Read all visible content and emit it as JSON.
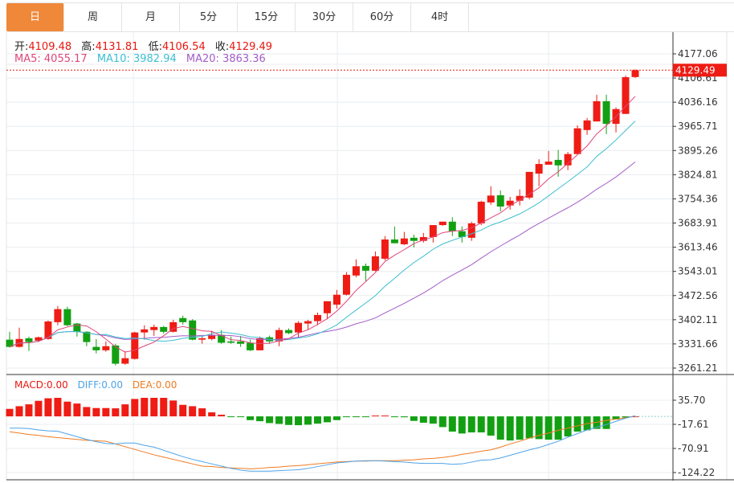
{
  "tabs": [
    "日",
    "周",
    "月",
    "5分",
    "15分",
    "30分",
    "60分",
    "4时"
  ],
  "active_tab": 0,
  "ohlc_info": {
    "open_label": "开:",
    "open": "4109.48",
    "high_label": "高:",
    "high": "4131.81",
    "low_label": "低:",
    "low": "4106.54",
    "close_label": "收:",
    "close": "4129.49"
  },
  "ma_info": {
    "ma5_label": "MA5:",
    "ma5": "4055.17",
    "ma10_label": "MA10:",
    "ma10": "3982.94",
    "ma20_label": "MA20:",
    "ma20": "3863.36"
  },
  "macd_info": {
    "macd_label": "MACD:",
    "macd": "0.00",
    "diff_label": "DIFF:",
    "diff": "0.00",
    "dea_label": "DEA:",
    "dea": "0.00"
  },
  "colors": {
    "tab_active": "#F0883A",
    "up": "#EE1C14",
    "down": "#12A012",
    "ma5": "#E0457B",
    "ma10": "#3CBFD0",
    "ma20": "#A45CC8",
    "diff": "#4DA3E8",
    "dea": "#F07A20"
  },
  "price_axis": {
    "ticks": [
      "4177.06",
      "4106.61",
      "4036.16",
      "3965.71",
      "3895.26",
      "3824.81",
      "3754.36",
      "3683.91",
      "3613.46",
      "3543.01",
      "3472.56",
      "3402.11",
      "3331.66",
      "3261.21"
    ],
    "current_price": "4129.49"
  },
  "macd_axis": {
    "ticks": [
      "35.70",
      "-17.61",
      "-70.91",
      "-124.22"
    ]
  },
  "chart_data": {
    "type": "candlestick",
    "open": [
      3344,
      3323,
      3348,
      3341,
      3346,
      3395,
      3433,
      3391,
      3367,
      3323,
      3313,
      3327,
      3274,
      3288,
      3365,
      3372,
      3381,
      3367,
      3407,
      3400,
      3344,
      3346,
      3358,
      3339,
      3339,
      3335,
      3313,
      3351,
      3339,
      3372,
      3365,
      3391,
      3398,
      3421,
      3446,
      3475,
      3531,
      3559,
      3545,
      3580,
      3636,
      3622,
      3641,
      3632,
      3643,
      3678,
      3688,
      3660,
      3641,
      3683,
      3744,
      3765,
      3735,
      3749,
      3758,
      3828,
      3854,
      3868,
      3852,
      3885,
      3955,
      3980,
      4039,
      3973,
      4002,
      4109.48
    ],
    "high": [
      3367,
      3379,
      3353,
      3353,
      3400,
      3442,
      3440,
      3393,
      3369,
      3346,
      3339,
      3332,
      3311,
      3367,
      3386,
      3388,
      3384,
      3402,
      3414,
      3404,
      3353,
      3370,
      3372,
      3353,
      3355,
      3344,
      3353,
      3356,
      3379,
      3377,
      3398,
      3402,
      3423,
      3456,
      3489,
      3541,
      3578,
      3566,
      3601,
      3646,
      3674,
      3658,
      3650,
      3655,
      3655,
      3685,
      3701,
      3674,
      3688,
      3749,
      3791,
      3779,
      3760,
      3782,
      3833,
      3870,
      3894,
      3897,
      3891,
      3969,
      3990,
      4058,
      4058,
      4021,
      4114,
      4131.81
    ],
    "low": [
      3321,
      3321,
      3311,
      3337,
      3344,
      3386,
      3383,
      3353,
      3325,
      3304,
      3309,
      3269,
      3271,
      3286,
      3344,
      3355,
      3362,
      3365,
      3388,
      3342,
      3332,
      3342,
      3332,
      3332,
      3323,
      3311,
      3313,
      3332,
      3325,
      3360,
      3351,
      3374,
      3386,
      3405,
      3435,
      3473,
      3526,
      3515,
      3543,
      3575,
      3625,
      3620,
      3613,
      3627,
      3627,
      3676,
      3646,
      3627,
      3632,
      3678,
      3737,
      3718,
      3723,
      3735,
      3753,
      3791,
      3856,
      3819,
      3838,
      3885,
      3941,
      3980,
      3943,
      3948,
      4002,
      4106.54
    ],
    "close": [
      3323,
      3346,
      3337,
      3351,
      3397,
      3433,
      3386,
      3367,
      3337,
      3313,
      3325,
      3274,
      3290,
      3365,
      3374,
      3381,
      3367,
      3395,
      3395,
      3344,
      3348,
      3358,
      3335,
      3335,
      3332,
      3313,
      3348,
      3339,
      3372,
      3363,
      3393,
      3398,
      3416,
      3456,
      3475,
      3533,
      3558,
      3545,
      3587,
      3636,
      3625,
      3639,
      3632,
      3643,
      3678,
      3688,
      3660,
      3643,
      3683,
      3746,
      3764,
      3732,
      3749,
      3763,
      3833,
      3856,
      3863,
      3852,
      3885,
      3960,
      3983,
      4039,
      3973,
      4016,
      4109,
      4129.49
    ],
    "macd_hist": [
      16.6,
      22.5,
      26.6,
      34.3,
      40,
      41,
      32.6,
      28.4,
      20.7,
      18.4,
      18.4,
      17.8,
      26.6,
      38.5,
      41,
      41,
      41,
      35,
      25.5,
      22.5,
      17.8,
      8.9,
      3.6,
      -1,
      -1.2,
      -8.3,
      -10.7,
      -14.8,
      -16.6,
      -19,
      -19.5,
      -18.4,
      -16,
      -13,
      -8.3,
      -1.2,
      -0.5,
      -0.5,
      1.8,
      1.8,
      -0.5,
      -2,
      -10,
      -14,
      -16,
      -23.7,
      -33.7,
      -37.9,
      -35.5,
      -35.5,
      -42.6,
      -51.5,
      -53.3,
      -51.5,
      -48.5,
      -50.3,
      -51.5,
      -51.5,
      -44.4,
      -33.7,
      -30.8,
      -27.8,
      -27.8,
      -7,
      -2.4,
      0
    ],
    "diff": [
      -26,
      -26,
      -27,
      -30,
      -32,
      -33,
      -39,
      -45,
      -51,
      -56,
      -60,
      -61,
      -59,
      -59,
      -64,
      -68,
      -75,
      -82,
      -89,
      -95,
      -100,
      -105,
      -110,
      -115,
      -119,
      -121,
      -121,
      -121,
      -120,
      -119,
      -118,
      -115,
      -111,
      -107,
      -103,
      -101,
      -99,
      -98,
      -98,
      -99,
      -100,
      -101,
      -103,
      -104,
      -104,
      -104,
      -106,
      -105,
      -101,
      -97,
      -96,
      -92,
      -86,
      -80,
      -74,
      -69,
      -62,
      -55,
      -46,
      -38,
      -30,
      -24,
      -18,
      -11,
      -4,
      1
    ],
    "dea": [
      -34,
      -37,
      -40,
      -42,
      -45,
      -47,
      -49,
      -51,
      -53,
      -54,
      -55,
      -61,
      -67,
      -73,
      -79,
      -85,
      -90,
      -95,
      -100,
      -105,
      -110,
      -111,
      -113,
      -114,
      -115,
      -116,
      -115,
      -113,
      -112,
      -110,
      -109,
      -107,
      -105,
      -103,
      -101,
      -100,
      -99,
      -99,
      -98,
      -98,
      -98,
      -97,
      -96,
      -94,
      -93,
      -91,
      -88,
      -84,
      -81,
      -77,
      -74,
      -68,
      -61,
      -55,
      -48,
      -42,
      -37,
      -31,
      -26,
      -21,
      -16,
      -13,
      -9,
      -6,
      -3,
      1
    ],
    "price_range": [
      3261.21,
      4177.06
    ],
    "macd_range": [
      -124.22,
      35.7
    ],
    "grid": true
  }
}
